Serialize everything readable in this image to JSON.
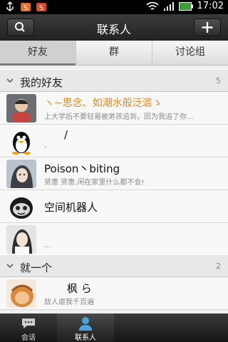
{
  "status_bar": {
    "time": "17:02"
  },
  "header": {
    "title": "联系人",
    "search_icon": "search-icon",
    "add_icon": "plus-icon"
  },
  "tabs": [
    {
      "label": "好友",
      "active": true
    },
    {
      "label": "群",
      "active": false
    },
    {
      "label": "讨论组",
      "active": false
    }
  ],
  "groups": [
    {
      "name": "我的好友",
      "count": "5",
      "contacts": [
        {
          "name": "ヽ~思念、如潮水般泛滥ゝ",
          "signature": "上大学后不要轻易被男孩追到，因为我追了你...",
          "highlight": true
        },
        {
          "name": "/",
          "signature": "-",
          "highlight": false
        },
        {
          "name": "Poison丶biting",
          "signature": "贤惠 贤惠,闲在家里什么都不会!",
          "highlight": false
        },
        {
          "name": "空间机器人",
          "signature": "",
          "highlight": false
        },
        {
          "name": "",
          "signature": "...",
          "highlight": false
        }
      ]
    },
    {
      "name": "就一个",
      "count": "2",
      "contacts": [
        {
          "name": "枫   ら",
          "signature": "敌人虐我千百遍",
          "highlight": false
        }
      ]
    }
  ],
  "bottom_nav": [
    {
      "label": "会话",
      "icon": "chat-bubble-icon",
      "active": false
    },
    {
      "label": "联系人",
      "icon": "person-icon",
      "active": true
    }
  ],
  "colors": {
    "highlight_name": "#e08a1e",
    "header_bg": "#2b2b2b"
  }
}
